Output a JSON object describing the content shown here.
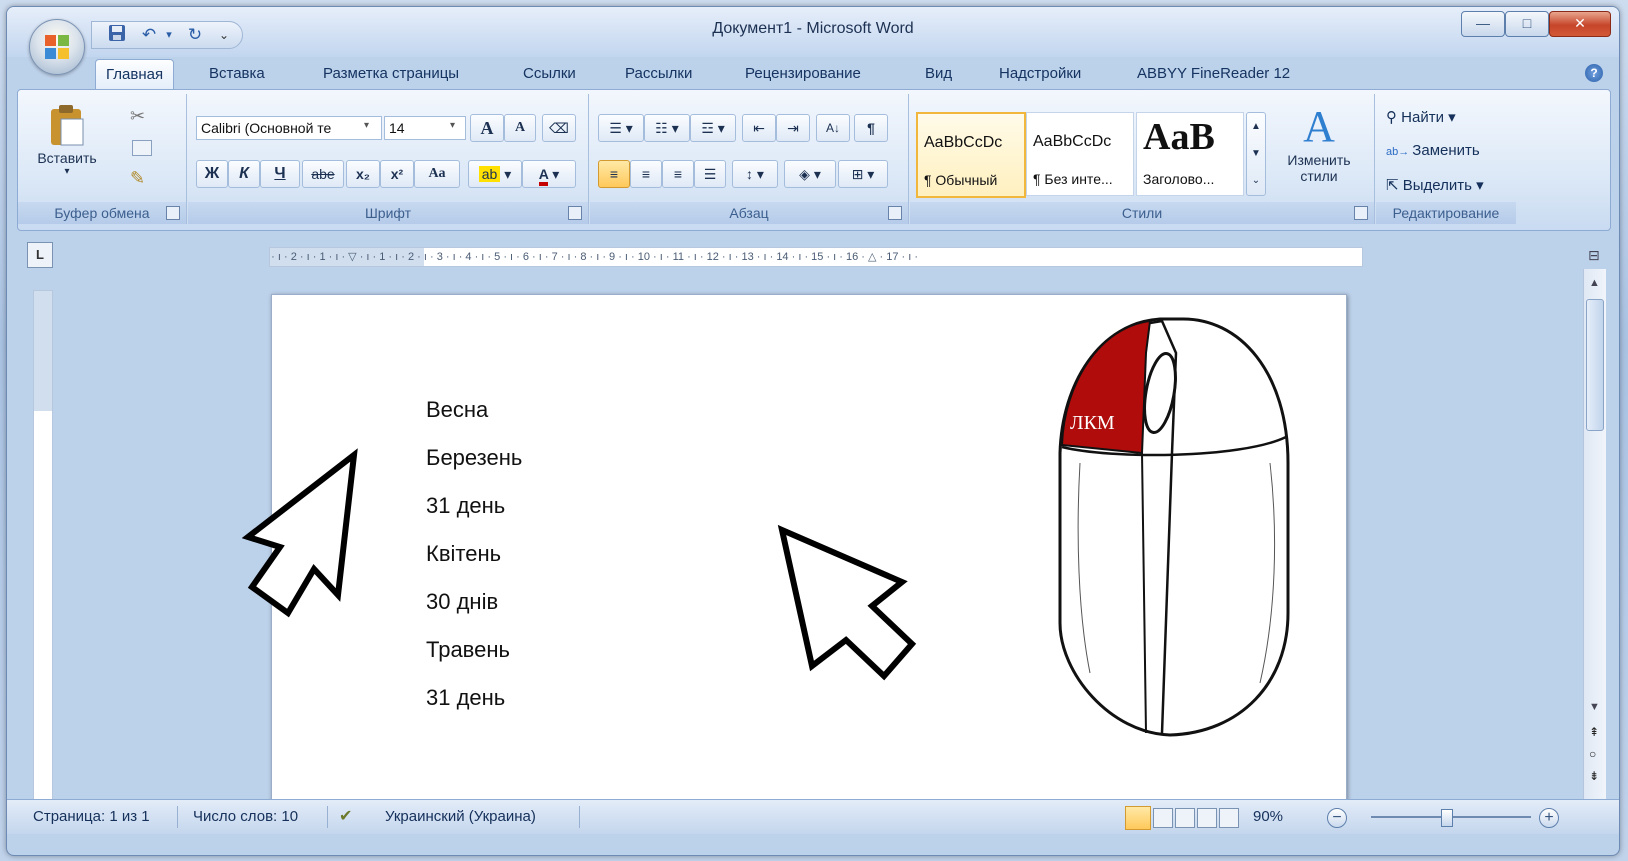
{
  "window": {
    "title": "Документ1 - Microsoft Word",
    "controls": {
      "minimize": "—",
      "maximize": "□",
      "close": "✕"
    }
  },
  "qat": {
    "save_icon": "save-icon",
    "undo_icon": "undo-icon",
    "redo_icon": "redo-icon",
    "customize": "⌄"
  },
  "tabs": [
    {
      "label": "Главная",
      "active": true
    },
    {
      "label": "Вставка"
    },
    {
      "label": "Разметка страницы"
    },
    {
      "label": "Ссылки"
    },
    {
      "label": "Рассылки"
    },
    {
      "label": "Рецензирование"
    },
    {
      "label": "Вид"
    },
    {
      "label": "Надстройки"
    },
    {
      "label": "ABBYY FineReader 12"
    }
  ],
  "ribbon": {
    "clipboard": {
      "label": "Буфер обмена",
      "paste": "Вставить"
    },
    "font": {
      "label": "Шрифт",
      "font_name": "Calibri (Основной те",
      "font_size": "14",
      "bold": "Ж",
      "italic": "К",
      "underline": "Ч",
      "strike": "abe",
      "sub": "x₂",
      "sup": "x²",
      "case": "Aa",
      "grow": "A",
      "shrink": "A"
    },
    "paragraph": {
      "label": "Абзац"
    },
    "styles": {
      "label": "Стили",
      "tiles": [
        {
          "sample": "AaBbCcDc",
          "name": "¶ Обычный",
          "selected": true
        },
        {
          "sample": "AaBbCcDc",
          "name": "¶ Без инте..."
        },
        {
          "sample": "AaB",
          "name": "Заголово..."
        }
      ],
      "change_styles": "Изменить стили"
    },
    "editing": {
      "label": "Редактирование",
      "find": "Найти",
      "replace": "Заменить",
      "select": "Выделить"
    }
  },
  "ruler": {
    "text": "3 · ı · 2 · ı · 1 · ı · ▽ · ı · 1 · ı · 2 · ı · 3 · ı · 4 · ı · 5 · ı · 6 · ı · 7 · ı · 8 · ı · 9 · ı · 10 · ı · 11 · ı · 12 · ı · 13 · ı · 14 · ı · 15 · ı · 16 · △ · 17 · ı ·",
    "corner": "L"
  },
  "document": {
    "lines": [
      "Весна",
      "Березень",
      "31 день",
      "Квітень",
      "30 днів",
      "Травень",
      "31 день"
    ],
    "mouse_label": "ЛКМ",
    "mouse_button_color": "#b00c0c"
  },
  "statusbar": {
    "page": "Страница: 1 из 1",
    "words": "Число слов: 10",
    "language": "Украинский (Украина)",
    "zoom": "90%"
  }
}
